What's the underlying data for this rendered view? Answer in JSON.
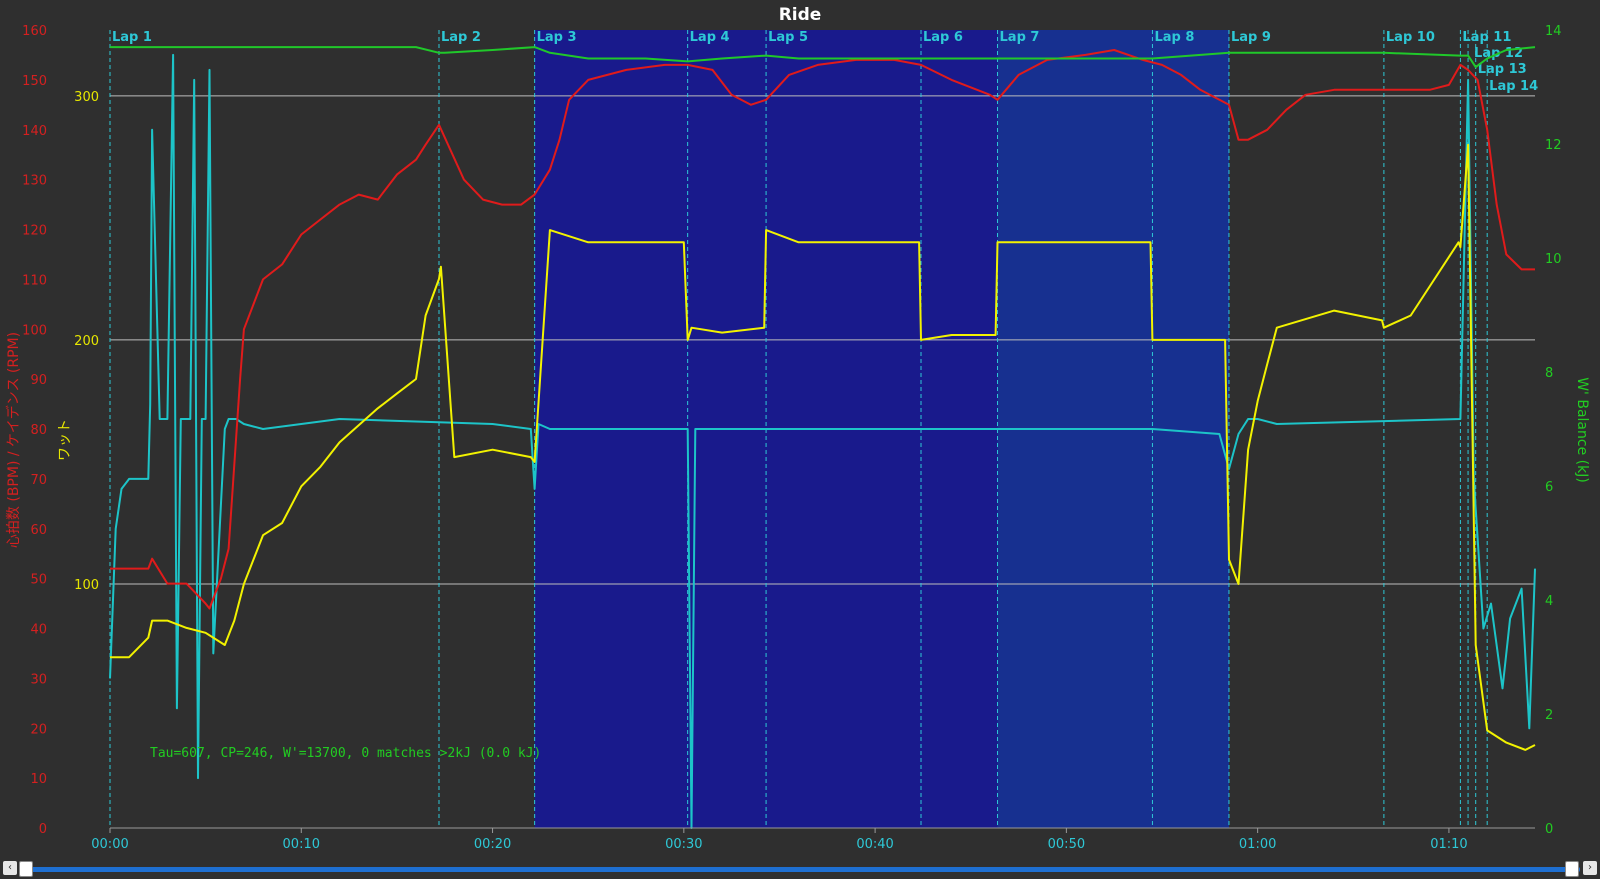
{
  "chart_data": {
    "type": "line",
    "title": "Ride",
    "x_unit": "elapsed time (h:mm)",
    "x_range_minutes": [
      0,
      74.5
    ],
    "x_ticks": [
      "00:00",
      "00:10",
      "00:20",
      "00:30",
      "00:40",
      "00:50",
      "01:00",
      "01:10"
    ],
    "y_axes": [
      {
        "id": "hr_cad",
        "label": "心拍数 (BPM) / ケイデンス (RPM)",
        "color": "#d42020",
        "range": [
          0,
          160
        ],
        "ticks": [
          "0",
          "10",
          "20",
          "30",
          "40",
          "50",
          "60",
          "70",
          "80",
          "90",
          "100",
          "110",
          "120",
          "130",
          "140",
          "150",
          "160"
        ]
      },
      {
        "id": "watts",
        "label": "ワット",
        "color": "#e6e600",
        "range": [
          0,
          327
        ],
        "ticks": [
          "100",
          "200",
          "300"
        ]
      },
      {
        "id": "wbal",
        "label": "W' Balance (kJ)",
        "color": "#22cc22",
        "range": [
          0,
          14
        ],
        "ticks": [
          "0",
          "2",
          "4",
          "6",
          "8",
          "10",
          "12",
          "14"
        ]
      }
    ],
    "grid": "horizontal at 100/200/300 W",
    "annotation": "Tau=607, CP=246, W'=13700, 0 matches >2kJ (0.0 kJ)",
    "laps": [
      {
        "label": "Lap 1",
        "start": 0.0
      },
      {
        "label": "Lap 2",
        "start": 17.2
      },
      {
        "label": "Lap 3",
        "start": 22.2
      },
      {
        "label": "Lap 4",
        "start": 30.2
      },
      {
        "label": "Lap 5",
        "start": 34.3
      },
      {
        "label": "Lap 6",
        "start": 42.4
      },
      {
        "label": "Lap 7",
        "start": 46.4
      },
      {
        "label": "Lap 8",
        "start": 54.5
      },
      {
        "label": "Lap 9",
        "start": 58.5
      },
      {
        "label": "Lap 10",
        "start": 66.6
      },
      {
        "label": "Lap 11",
        "start": 70.6
      },
      {
        "label": "Lap 12",
        "start": 71.0
      },
      {
        "label": "Lap 13",
        "start": 71.4
      },
      {
        "label": "Lap 14",
        "start": 72.0
      }
    ],
    "shaded_intervals": [
      {
        "start": 22.2,
        "end": 46.4,
        "color": "#191a8c"
      },
      {
        "start": 46.4,
        "end": 58.5,
        "color": "#173090"
      }
    ],
    "series": [
      {
        "name": "心拍数",
        "axis": "hr_cad",
        "color": "#e01b1b",
        "x": [
          0,
          0.8,
          2,
          2.2,
          3,
          4,
          5,
          5.2,
          5.8,
          6.2,
          6.8,
          7,
          8,
          9,
          10,
          11,
          12,
          13,
          14,
          15,
          16,
          16.5,
          17.2,
          18.5,
          19.5,
          20.5,
          21.5,
          22.2,
          23,
          23.5,
          24,
          25,
          27,
          29,
          30.2,
          31.5,
          32.5,
          33.5,
          34.3,
          35.5,
          37,
          39,
          41,
          42.4,
          44,
          46,
          46.4,
          47.5,
          49,
          51,
          52.5,
          54,
          55,
          56,
          57,
          58,
          58.5,
          59,
          59.5,
          60.5,
          61.5,
          62.5,
          64,
          66,
          67,
          68,
          69,
          70,
          70.6,
          71,
          71.5,
          72,
          72.5,
          73,
          73.8,
          74.5
        ],
        "y": [
          52,
          52,
          52,
          54,
          49,
          49,
          45,
          44,
          50,
          56,
          90,
          100,
          110,
          113,
          119,
          122,
          125,
          127,
          126,
          131,
          134,
          137,
          141,
          130,
          126,
          125,
          125,
          127,
          132,
          138,
          146,
          150,
          152,
          153,
          153,
          152,
          147,
          145,
          146,
          151,
          153,
          154,
          154,
          153,
          150,
          147,
          146,
          151,
          154,
          155,
          156,
          154,
          153,
          151,
          148,
          146,
          145,
          138,
          138,
          140,
          144,
          147,
          148,
          148,
          148,
          148,
          148,
          149,
          153,
          152,
          150,
          140,
          125,
          115,
          112,
          112
        ]
      },
      {
        "name": "ケイデンス",
        "axis": "hr_cad",
        "color": "#1dc4c8",
        "x": [
          0,
          0.3,
          0.6,
          1,
          2,
          2.1,
          2.2,
          2.6,
          3,
          3.3,
          3.5,
          3.7,
          4.2,
          4.4,
          4.6,
          4.8,
          5,
          5.2,
          5.4,
          6,
          6.2,
          6.6,
          7,
          8,
          12,
          20,
          22,
          22.2,
          22.4,
          23,
          30,
          30.2,
          30.4,
          30.6,
          31,
          34.3,
          40,
          46.4,
          54.5,
          58,
          58.5,
          59,
          59.5,
          60,
          61,
          70.6,
          71,
          71.3,
          71.8,
          72.2,
          72.8,
          73.2,
          73.8,
          74.2,
          74.5
        ],
        "y": [
          30,
          60,
          68,
          70,
          70,
          85,
          140,
          82,
          82,
          155,
          24,
          82,
          82,
          150,
          10,
          82,
          82,
          152,
          35,
          80,
          82,
          82,
          81,
          80,
          82,
          81,
          80,
          68,
          81,
          80,
          80,
          80,
          0,
          80,
          80,
          80,
          80,
          80,
          80,
          79,
          72,
          79,
          82,
          82,
          81,
          82,
          150,
          70,
          40,
          45,
          28,
          42,
          48,
          20,
          52
        ]
      },
      {
        "name": "ワット",
        "axis": "watts",
        "color": "#f2f200",
        "x": [
          0,
          0.3,
          1,
          2,
          2.2,
          3,
          4,
          5,
          6,
          6.5,
          7,
          8,
          9,
          10,
          11,
          12,
          13,
          14,
          15,
          16,
          16.5,
          17.2,
          17.3,
          18,
          20,
          22,
          22.2,
          23,
          25,
          27,
          30,
          30.2,
          30.4,
          32,
          34.2,
          34.3,
          36,
          38,
          40,
          42.3,
          42.4,
          44,
          46.3,
          46.4,
          48,
          50,
          52,
          54.4,
          54.5,
          56,
          58.3,
          58.5,
          59,
          59.5,
          60,
          60.5,
          61,
          64,
          66.5,
          66.6,
          68,
          70.5,
          70.6,
          71,
          71.4,
          72,
          73,
          74,
          74.5
        ],
        "y": [
          70,
          70,
          70,
          78,
          85,
          85,
          82,
          80,
          75,
          85,
          100,
          120,
          125,
          140,
          148,
          158,
          165,
          172,
          178,
          184,
          210,
          225,
          230,
          152,
          155,
          152,
          150,
          245,
          240,
          240,
          240,
          200,
          205,
          203,
          205,
          245,
          240,
          240,
          240,
          240,
          200,
          202,
          202,
          240,
          240,
          240,
          240,
          240,
          200,
          200,
          200,
          110,
          100,
          155,
          175,
          190,
          205,
          212,
          208,
          205,
          210,
          240,
          238,
          280,
          75,
          40,
          35,
          32,
          34
        ]
      },
      {
        "name": "W' Balance",
        "axis": "wbal",
        "color": "#20c82a",
        "x": [
          0,
          10,
          16,
          17.2,
          17.5,
          20,
          22.2,
          23,
          25,
          28,
          30.2,
          32,
          34.3,
          36,
          40,
          42.4,
          44,
          46.4,
          50,
          54.5,
          58.5,
          62,
          66.6,
          70.6,
          71,
          71.4,
          72,
          73,
          74.5
        ],
        "y": [
          13.7,
          13.7,
          13.7,
          13.6,
          13.6,
          13.65,
          13.7,
          13.6,
          13.5,
          13.5,
          13.45,
          13.5,
          13.55,
          13.5,
          13.5,
          13.5,
          13.5,
          13.5,
          13.5,
          13.5,
          13.6,
          13.6,
          13.6,
          13.55,
          13.55,
          13.35,
          13.5,
          13.65,
          13.7
        ]
      }
    ]
  },
  "scrollbar": {
    "left_btn": "‹",
    "right_btn": "›"
  }
}
